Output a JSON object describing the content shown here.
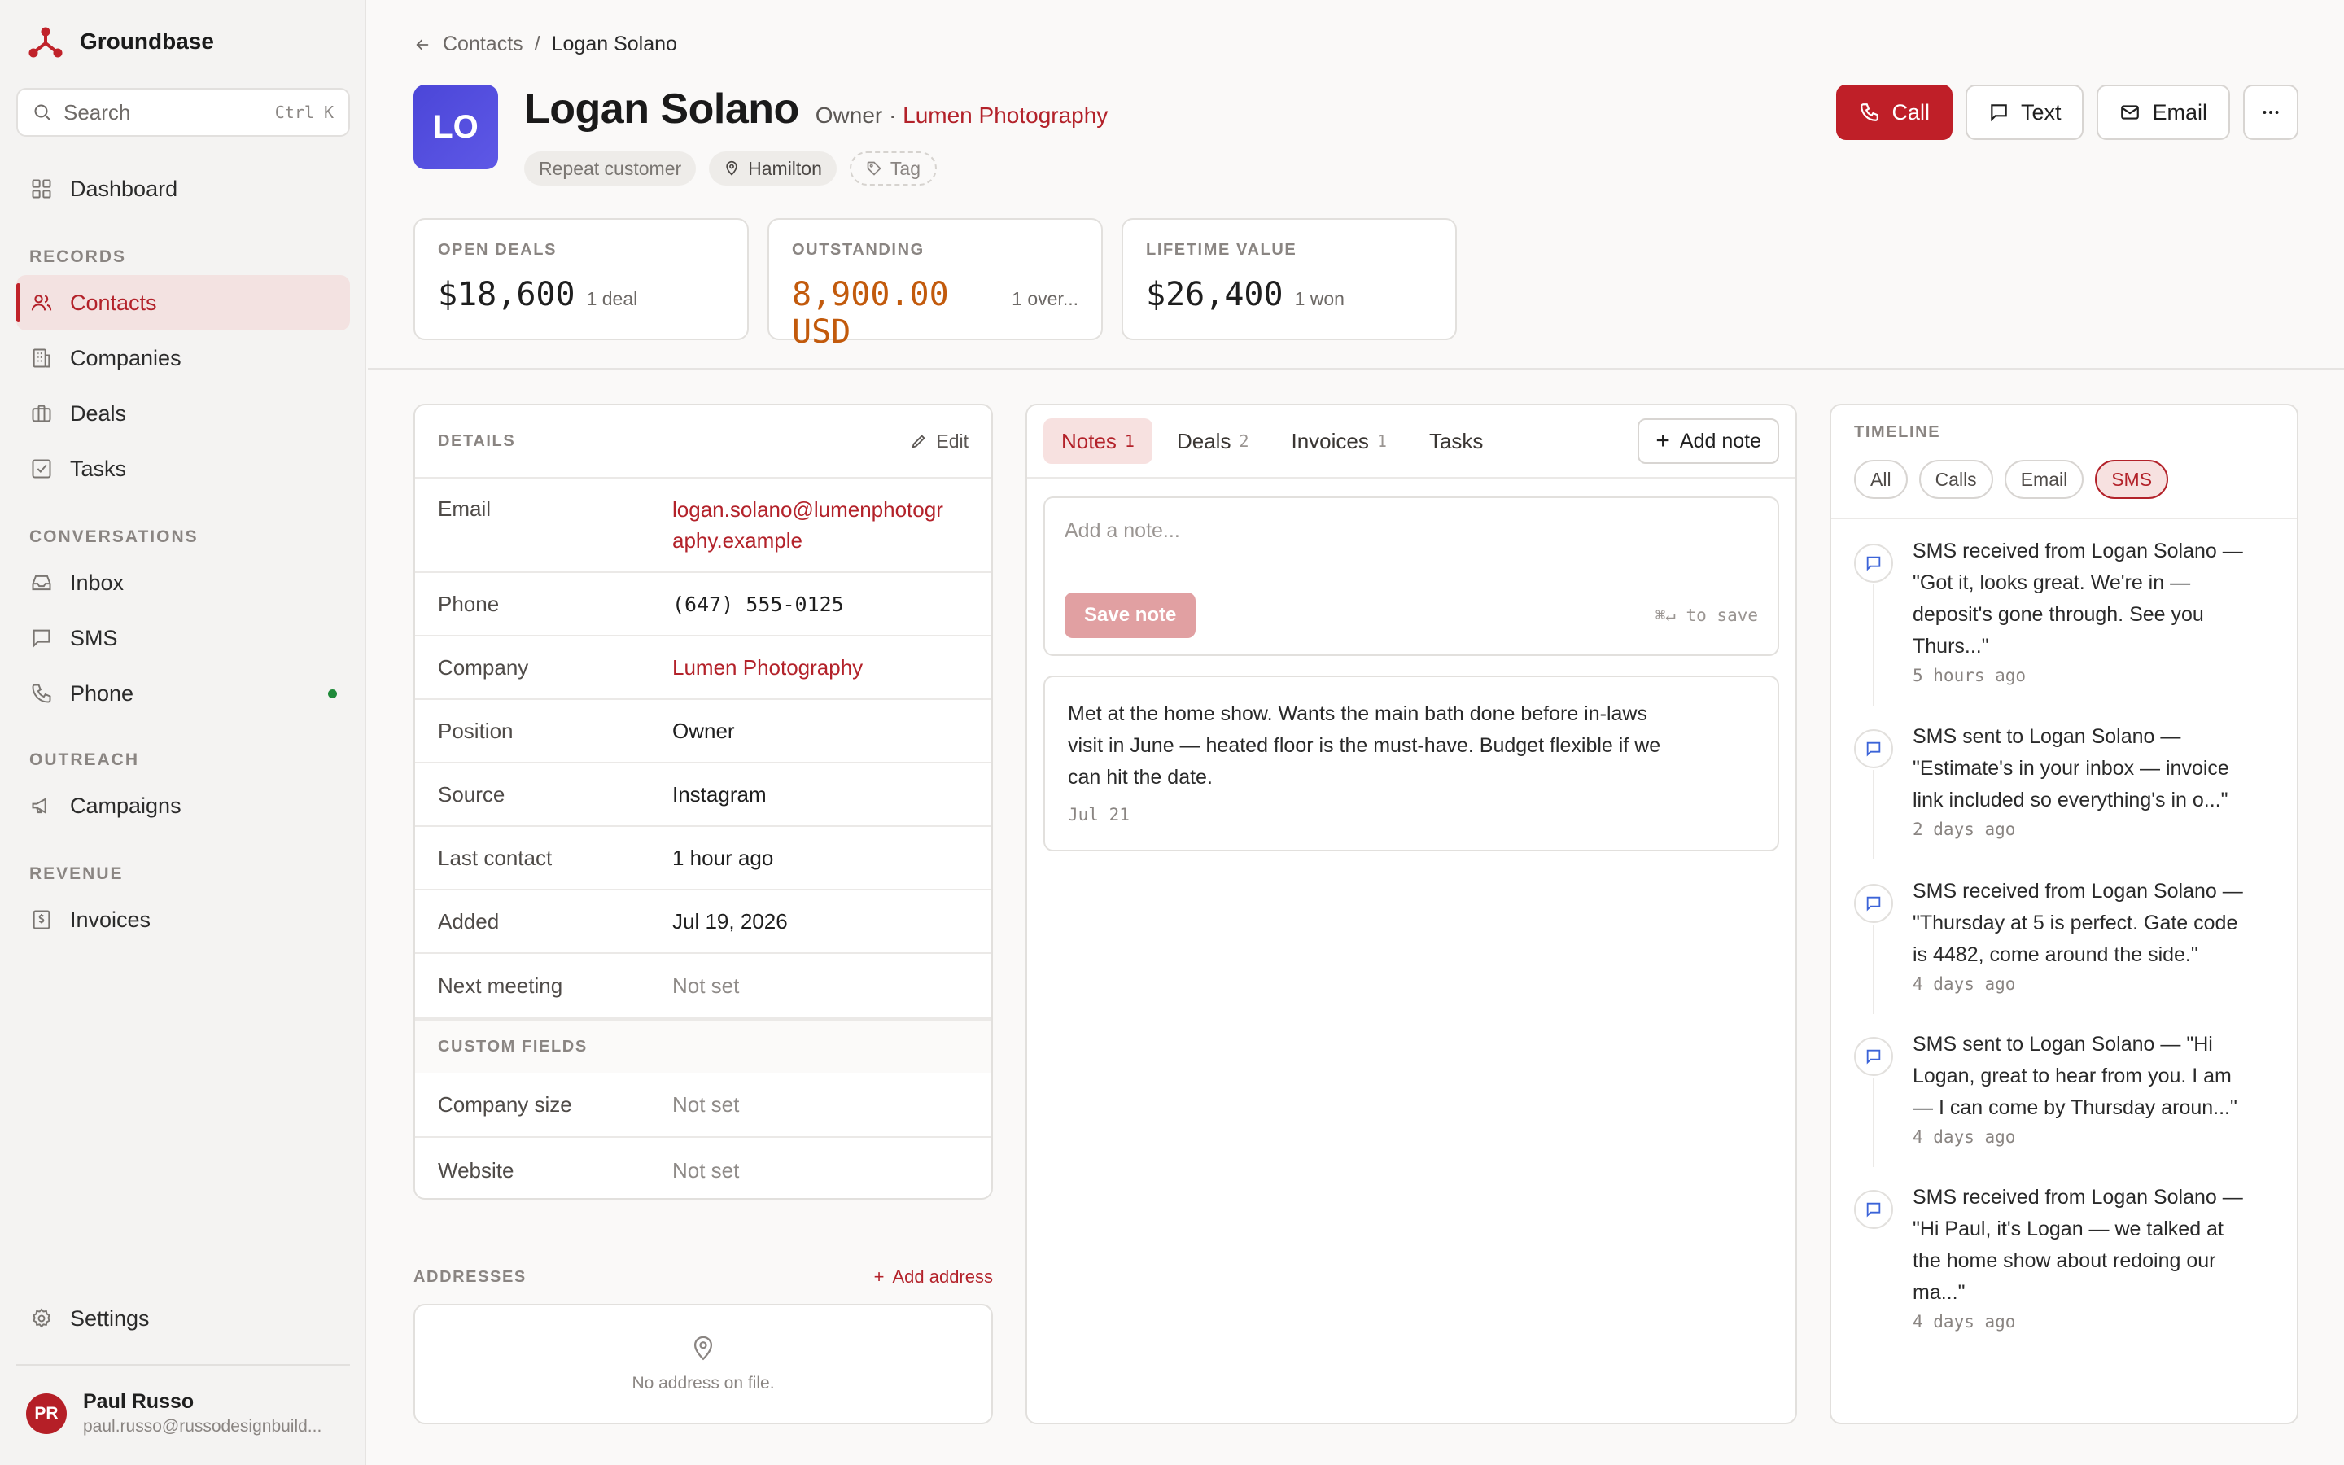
{
  "app": {
    "name": "Groundbase"
  },
  "search": {
    "placeholder": "Search",
    "shortcut": "Ctrl K"
  },
  "nav": {
    "dashboard": "Dashboard",
    "records_label": "RECORDS",
    "contacts": "Contacts",
    "companies": "Companies",
    "deals": "Deals",
    "tasks": "Tasks",
    "conversations_label": "CONVERSATIONS",
    "inbox": "Inbox",
    "sms": "SMS",
    "phone": "Phone",
    "outreach_label": "OUTREACH",
    "campaigns": "Campaigns",
    "revenue_label": "REVENUE",
    "invoices": "Invoices",
    "settings": "Settings"
  },
  "user": {
    "initials": "PR",
    "name": "Paul Russo",
    "email": "paul.russo@russodesignbuild..."
  },
  "breadcrumb": {
    "parent": "Contacts",
    "sep": "/",
    "current": "Logan Solano"
  },
  "contact": {
    "initials": "LO",
    "name": "Logan Solano",
    "role": "Owner ·",
    "company": "Lumen Photography",
    "tags": {
      "repeat": "Repeat customer",
      "location": "Hamilton",
      "add": "Tag"
    }
  },
  "actions": {
    "call": "Call",
    "text": "Text",
    "email": "Email"
  },
  "stats": [
    {
      "label": "OPEN DEALS",
      "value": "$18,600",
      "sub": "1 deal"
    },
    {
      "label": "OUTSTANDING",
      "value": "8,900.00 USD",
      "sub": "1 over..."
    },
    {
      "label": "LIFETIME VALUE",
      "value": "$26,400",
      "sub": "1 won"
    }
  ],
  "details": {
    "title": "DETAILS",
    "edit": "Edit",
    "rows": [
      {
        "key": "Email",
        "value": "logan.solano@lumenphotogr",
        "value2": "aphy.example"
      },
      {
        "key": "Phone",
        "value": "(647) 555-0125"
      },
      {
        "key": "Company",
        "value": "Lumen Photography"
      },
      {
        "key": "Position",
        "value": "Owner"
      },
      {
        "key": "Source",
        "value": "Instagram"
      },
      {
        "key": "Last contact",
        "value": "1 hour ago"
      },
      {
        "key": "Added",
        "value": "Jul 19, 2026"
      },
      {
        "key": "Next meeting",
        "value": "Not set"
      }
    ],
    "custom_title": "CUSTOM FIELDS",
    "custom_rows": [
      {
        "key": "Company size",
        "value": "Not set"
      },
      {
        "key": "Website",
        "value": "Not set"
      }
    ]
  },
  "addresses": {
    "title": "ADDRESSES",
    "add": "Add address",
    "empty": "No address on file."
  },
  "notes_panel": {
    "tabs": [
      {
        "label": "Notes",
        "count": "1"
      },
      {
        "label": "Deals",
        "count": "2"
      },
      {
        "label": "Invoices",
        "count": "1"
      },
      {
        "label": "Tasks",
        "count": ""
      }
    ],
    "add_note": "Add note",
    "composer_placeholder": "Add a note...",
    "save": "Save note",
    "hint": "⌘↵ to save",
    "notes": [
      {
        "lines": [
          "Met at the home show. Wants the main bath done before in-laws",
          "visit in June — heated floor is the must-have. Budget flexible if we",
          "can hit the date."
        ],
        "date": "Jul 21"
      }
    ]
  },
  "timeline": {
    "title": "TIMELINE",
    "filters": [
      "All",
      "Calls",
      "Email",
      "SMS"
    ],
    "active_filter": "SMS",
    "items": [
      {
        "lines": [
          "SMS received from Logan Solano —",
          "\"Got it, looks great. We're in —",
          "deposit's gone through. See you",
          "Thurs...\""
        ],
        "ago": "5 hours ago"
      },
      {
        "lines": [
          "SMS sent to Logan Solano —",
          "\"Estimate's in your inbox — invoice",
          "link included so everything's in o...\""
        ],
        "ago": "2 days ago"
      },
      {
        "lines": [
          "SMS received from Logan Solano —",
          "\"Thursday at 5 is perfect. Gate code",
          "is 4482, come around the side.\""
        ],
        "ago": "4 days ago"
      },
      {
        "lines": [
          "SMS sent to Logan Solano — \"Hi",
          "Logan, great to hear from you. I am",
          "— I can come by Thursday aroun...\""
        ],
        "ago": "4 days ago"
      },
      {
        "lines": [
          "SMS received from Logan Solano —",
          "\"Hi Paul, it's Logan — we talked at",
          "the home show about redoing our",
          "ma...\""
        ],
        "ago": "4 days ago"
      }
    ]
  },
  "colors": {
    "accent": "#bf1f28",
    "avatar": "#4b46d8",
    "warn": "#c25a0c",
    "online": "#1f8a3a"
  }
}
